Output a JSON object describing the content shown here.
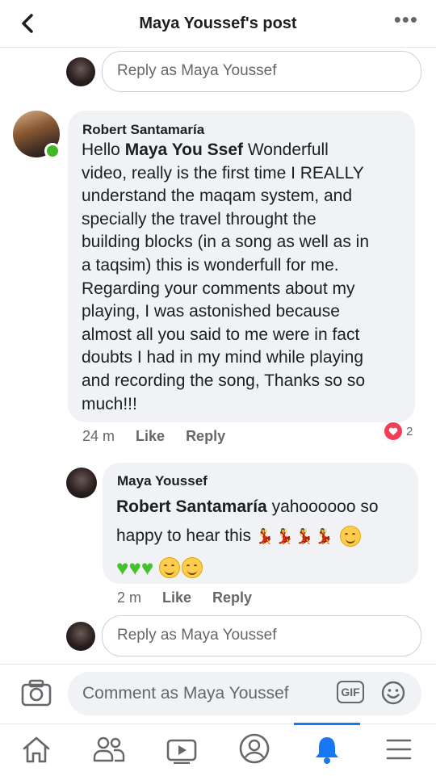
{
  "header": {
    "title": "Maya Youssef's post",
    "back_icon": "chevron-left-icon",
    "more_icon": "more-horizontal-icon",
    "more_glyph": "•••"
  },
  "reply_top": {
    "placeholder": "Reply as Maya Youssef"
  },
  "comments": [
    {
      "author": "Robert Santamaría",
      "online": true,
      "text_greeting": "Hello ",
      "mention": "Maya You Ssef",
      "text_lines": [
        " Wonderfull",
        "video, really is the first time I REALLY",
        "understand  the maqam system, and",
        "specially the travel throught the",
        "building blocks (in a song as well as in",
        "a taqsim) this is wonderfull for me.",
        "Regarding your comments about my",
        "playing, I was astonished because",
        "almost all you said to me were in fact",
        "doubts I had in my mind while playing",
        "and recording the song, Thanks so so",
        "much!!!"
      ],
      "time": "24 m",
      "like_label": "Like",
      "reply_label": "Reply",
      "reaction_count": "2",
      "reaction_icon": "heart-reaction-icon"
    },
    {
      "author": "Maya Youssef",
      "mention": "Robert Santamaría",
      "text_a": " yahoooooo so",
      "text_b": "happy to hear this",
      "dancer_glyph": "💃",
      "heart_glyph": "♥",
      "time": "2 m",
      "like_label": "Like",
      "reply_label": "Reply"
    }
  ],
  "reply_bottom": {
    "placeholder": "Reply as Maya Youssef"
  },
  "composer": {
    "placeholder": "Comment as Maya Youssef",
    "gif_label": "GIF",
    "camera_icon": "camera-icon",
    "emoji_icon": "smiley-icon"
  },
  "nav": {
    "items": [
      "home-icon",
      "friends-icon",
      "watch-icon",
      "profile-icon",
      "notifications-icon",
      "menu-icon"
    ],
    "active": "notifications-icon",
    "accent_color": "#1877f2"
  }
}
